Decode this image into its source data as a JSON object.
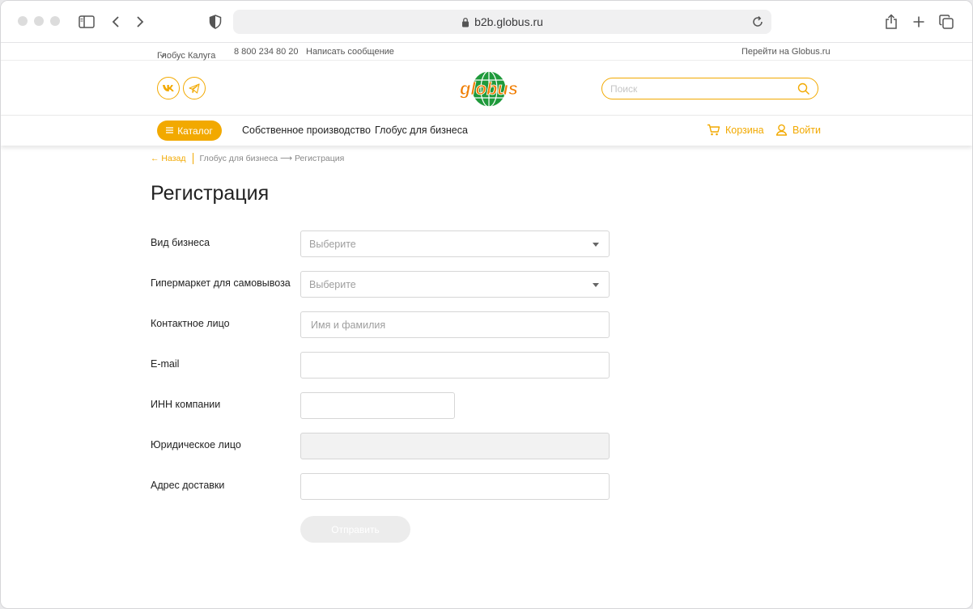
{
  "browser": {
    "url": "b2b.globus.ru"
  },
  "top_strip": {
    "city": "Глобус Калуга",
    "phone": "8 800 234 80 20",
    "message_link": "Написать сообщение",
    "main_site_link": "Перейти на Globus.ru"
  },
  "header": {
    "logo_text": "globus",
    "search_placeholder": "Поиск"
  },
  "nav": {
    "catalog_label": "Каталог",
    "links": [
      "Собственное производство",
      "Глобус для бизнеса"
    ],
    "cart_label": "Корзина",
    "login_label": "Войти"
  },
  "breadcrumb": {
    "back_label": "← Назад",
    "path": "Глобус для бизнеса ⟶ Регистрация"
  },
  "page": {
    "title": "Регистрация"
  },
  "form": {
    "business_type": {
      "label": "Вид бизнеса",
      "placeholder": "Выберите"
    },
    "pickup_store": {
      "label": "Гипермаркет для самовывоза",
      "placeholder": "Выберите"
    },
    "contact_person": {
      "label": "Контактное лицо",
      "placeholder": "Имя и фамилия",
      "value": ""
    },
    "email": {
      "label": "E-mail",
      "placeholder": "",
      "value": ""
    },
    "inn": {
      "label": "ИНН компании",
      "placeholder": "",
      "value": ""
    },
    "legal_entity": {
      "label": "Юридическое лицо",
      "placeholder": "",
      "value": ""
    },
    "delivery_address": {
      "label": "Адрес доставки",
      "placeholder": "",
      "value": ""
    },
    "submit_label": "Отправить"
  },
  "colors": {
    "accent": "#f2a900",
    "logo_orange": "#f07d00",
    "logo_green": "#1f9a3b"
  }
}
